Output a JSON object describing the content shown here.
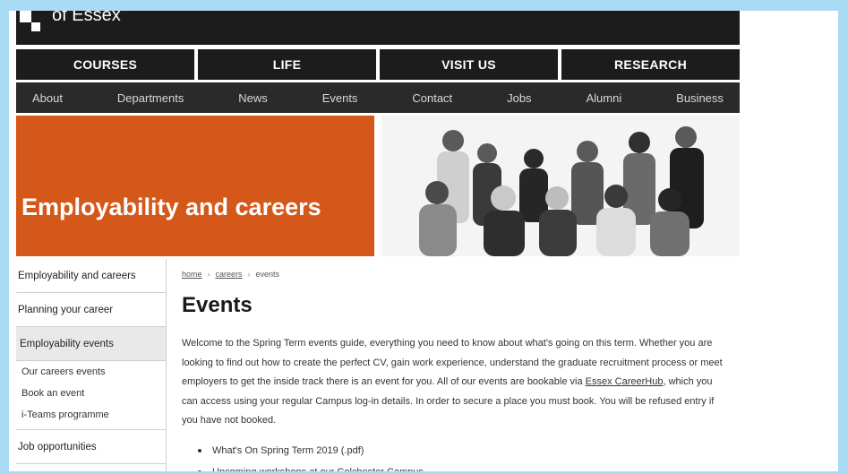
{
  "brand": {
    "logo_text": "of Essex"
  },
  "main_nav": [
    "COURSES",
    "LIFE",
    "VISIT US",
    "RESEARCH"
  ],
  "sub_nav": [
    "About",
    "Departments",
    "News",
    "Events",
    "Contact",
    "Jobs",
    "Alumni",
    "Business"
  ],
  "hero": {
    "title": "Employability and careers",
    "accent_color": "#d4581a"
  },
  "sidebar": {
    "items": [
      {
        "label": "Employability and careers"
      },
      {
        "label": "Planning your career"
      },
      {
        "label": "Employability events"
      }
    ],
    "sub_items": [
      "Our careers events",
      "Book an event",
      "i-Teams programme"
    ],
    "after": "Job opportunities"
  },
  "breadcrumb": [
    "home",
    "careers",
    "events"
  ],
  "page": {
    "title": "Events",
    "intro_part1": "Welcome to the Spring Term events guide, everything you need to know about what's going on this term. Whether you are looking to find out how to create the perfect CV, gain work experience, understand the graduate recruitment process or meet employers to get the inside track there is an event for you. All of our events are bookable via ",
    "intro_link": "Essex CareerHub",
    "intro_part2": ", which you can access using your regular Campus log-in details. In order to secure a place you must book. You will be refused entry if you have not booked.",
    "bullets": [
      "What's On Spring Term 2019 (.pdf)",
      "Upcoming workshops at our Colchester Campus"
    ]
  },
  "colors": {
    "frame": "#a9dbf5",
    "nav_bg": "#1c1c1c",
    "subnav_bg": "#2a2a2a"
  }
}
